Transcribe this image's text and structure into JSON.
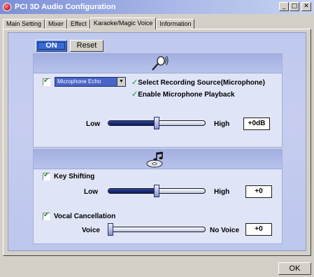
{
  "window": {
    "title": "PCI 3D Audio Configuration"
  },
  "tabs": [
    {
      "label": "Main Setting",
      "active": false
    },
    {
      "label": "Mixer",
      "active": false
    },
    {
      "label": "Effect",
      "active": false
    },
    {
      "label": "Karaoke/Magic Voice",
      "active": true
    },
    {
      "label": "Information",
      "active": false
    }
  ],
  "toolbar": {
    "on_label": "ON",
    "reset_label": "Reset"
  },
  "microphone": {
    "enabled": true,
    "effect_value": "Microphone Echo",
    "select_source_label": "Select Recording Source(Microphone)",
    "playback_label": "Enable Microphone Playback",
    "level": {
      "low_label": "Low",
      "high_label": "High",
      "value": "+0dB",
      "position": 0.5
    }
  },
  "key_shifting": {
    "enabled": true,
    "label": "Key Shifting",
    "low_label": "Low",
    "high_label": "High",
    "value": "+0",
    "position": 0.5
  },
  "vocal_cancellation": {
    "enabled": true,
    "label": "Vocal Cancellation",
    "low_label": "Voice",
    "high_label": "No Voice",
    "value": "+0",
    "position": 0.0
  },
  "footer": {
    "ok_label": "OK"
  },
  "icons": {
    "app": "audio-config-icon",
    "microphone": "microphone-icon",
    "music": "music-cd-icon"
  },
  "colors": {
    "accent": "#3a6ad8",
    "panel": "#c6cdef",
    "check": "#2a8a2a"
  }
}
